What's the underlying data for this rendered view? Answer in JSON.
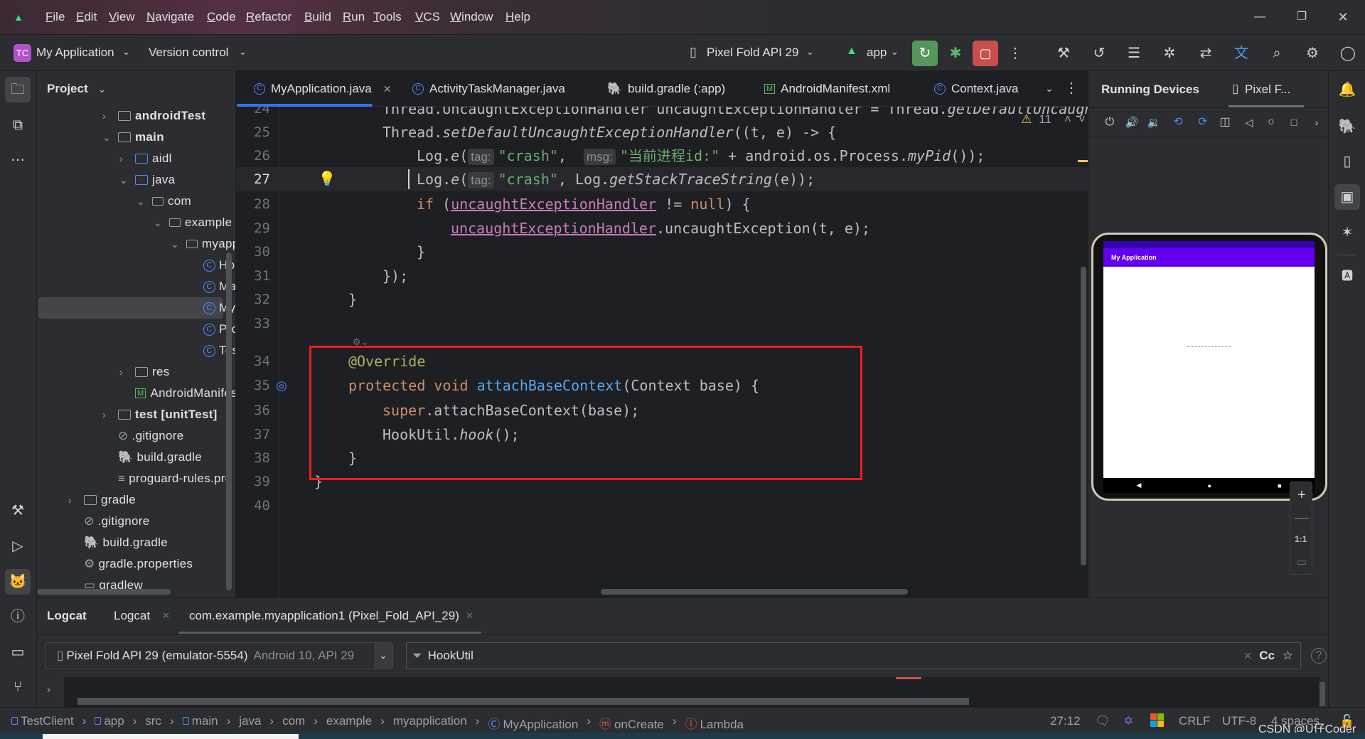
{
  "menubar": {
    "items": [
      "File",
      "Edit",
      "View",
      "Navigate",
      "Code",
      "Refactor",
      "Build",
      "Run",
      "Tools",
      "VCS",
      "Window",
      "Help"
    ]
  },
  "toolbar": {
    "project_badge": "TC",
    "project_name": "My Application",
    "version_control": "Version control",
    "device": "Pixel Fold API 29",
    "run_config": "app"
  },
  "project_panel": {
    "title": "Project",
    "items": [
      {
        "label": "androidTest",
        "type": "folder-src"
      },
      {
        "label": "main",
        "type": "folder-src"
      },
      {
        "label": "aidl",
        "type": "folder-blue"
      },
      {
        "label": "java",
        "type": "folder-blue"
      },
      {
        "label": "com",
        "type": "package"
      },
      {
        "label": "example",
        "type": "package"
      },
      {
        "label": "myapplication",
        "type": "package"
      },
      {
        "label": "HookUtil",
        "type": "class"
      },
      {
        "label": "MainActivity",
        "type": "class"
      },
      {
        "label": "MyApplication",
        "type": "class"
      },
      {
        "label": "ProxyActivity",
        "type": "class"
      },
      {
        "label": "TestActivity",
        "type": "class"
      },
      {
        "label": "res",
        "type": "folder-res"
      },
      {
        "label": "AndroidManifest.xml",
        "type": "manifest"
      },
      {
        "label": "test [unitTest]",
        "type": "folder-test"
      },
      {
        "label": ".gitignore",
        "type": "ignore"
      },
      {
        "label": "build.gradle",
        "type": "gradle"
      },
      {
        "label": "proguard-rules.pro",
        "type": "text"
      },
      {
        "label": "gradle",
        "type": "folder"
      },
      {
        "label": ".gitignore",
        "type": "ignore"
      },
      {
        "label": "build.gradle",
        "type": "gradle"
      },
      {
        "label": "gradle.properties",
        "type": "settings"
      },
      {
        "label": "gradlew",
        "type": "terminal"
      }
    ]
  },
  "editor": {
    "tabs": [
      {
        "label": "MyApplication.java",
        "active": true
      },
      {
        "label": "ActivityTaskManager.java"
      },
      {
        "label": "build.gradle (:app)"
      },
      {
        "label": "AndroidManifest.xml"
      },
      {
        "label": "Context.java"
      }
    ],
    "warning_count": "11",
    "current_line": 27,
    "lines": [
      {
        "n": "24",
        "indent": 2,
        "tokens": [
          [
            "Thread.UncaughtExceptionHandler uncaughtExceptionHandler = Thread.",
            ""
          ],
          [
            "getDefaultUncaughtExceptionHandler",
            "it"
          ],
          [
            "();",
            ""
          ]
        ]
      },
      {
        "n": "25",
        "indent": 2,
        "tokens": [
          [
            "Thread.",
            ""
          ],
          [
            "setDefaultUncaughtExceptionHandler",
            "it"
          ],
          [
            "((t, e) -> {",
            ""
          ]
        ]
      },
      {
        "n": "26",
        "indent": 3,
        "tokens": [
          [
            "Log.",
            ""
          ],
          [
            "e",
            "it"
          ],
          [
            "(",
            ""
          ],
          [
            "tag:",
            "hint"
          ],
          [
            "\"crash\"",
            "str"
          ],
          [
            ",  ",
            ""
          ],
          [
            "msg:",
            "hint"
          ],
          [
            "\"当前进程id:\"",
            "str"
          ],
          [
            " + android.os.Process.",
            ""
          ],
          [
            "myPid",
            "it"
          ],
          [
            "());",
            ""
          ]
        ]
      },
      {
        "n": "27",
        "indent": 3,
        "tokens": [
          [
            "Log.",
            ""
          ],
          [
            "e",
            "it"
          ],
          [
            "(",
            ""
          ],
          [
            "tag:",
            "hint"
          ],
          [
            "\"crash\"",
            "str"
          ],
          [
            ", Log.",
            ""
          ],
          [
            "getStackTraceString",
            "it"
          ],
          [
            "(e));",
            ""
          ]
        ]
      },
      {
        "n": "28",
        "indent": 3,
        "tokens": [
          [
            "if",
            "kw"
          ],
          [
            " (",
            ""
          ],
          [
            "uncaughtExceptionHandler",
            "fld"
          ],
          [
            " != ",
            ""
          ],
          [
            "null",
            "kw"
          ],
          [
            ") {",
            ""
          ]
        ]
      },
      {
        "n": "29",
        "indent": 4,
        "tokens": [
          [
            "uncaughtExceptionHandler",
            "fld"
          ],
          [
            ".uncaughtException(t, e);",
            ""
          ]
        ]
      },
      {
        "n": "30",
        "indent": 3,
        "tokens": [
          [
            "}",
            ""
          ]
        ]
      },
      {
        "n": "31",
        "indent": 2,
        "tokens": [
          [
            "});",
            ""
          ]
        ]
      },
      {
        "n": "32",
        "indent": 1,
        "tokens": [
          [
            "}",
            ""
          ]
        ]
      },
      {
        "n": "33",
        "indent": 0,
        "tokens": []
      },
      {
        "n": "34",
        "indent": 1,
        "tokens": [
          [
            "@Override",
            "ann"
          ]
        ]
      },
      {
        "n": "35",
        "indent": 1,
        "tokens": [
          [
            "protected void ",
            "kw"
          ],
          [
            "attachBaseContext",
            "mth"
          ],
          [
            "(Context base) {",
            ""
          ]
        ]
      },
      {
        "n": "36",
        "indent": 2,
        "tokens": [
          [
            "super",
            "kw"
          ],
          [
            ".attachBaseContext(base);",
            ""
          ]
        ]
      },
      {
        "n": "37",
        "indent": 2,
        "tokens": [
          [
            "HookUtil.",
            ""
          ],
          [
            "hook",
            "it"
          ],
          [
            "();",
            ""
          ]
        ]
      },
      {
        "n": "38",
        "indent": 1,
        "tokens": [
          [
            "}",
            ""
          ]
        ]
      },
      {
        "n": "39",
        "indent": 0,
        "tokens": [
          [
            "}",
            ""
          ]
        ]
      },
      {
        "n": "40",
        "indent": 0,
        "tokens": []
      }
    ]
  },
  "running_devices": {
    "title": "Running Devices",
    "device_tab": "Pixel F...",
    "app_title": "My Application",
    "zoom_reset": "1:1"
  },
  "logcat": {
    "title": "Logcat",
    "tabs": [
      {
        "label": "Logcat"
      },
      {
        "label": "com.example.myapplication1 (Pixel_Fold_API_29)",
        "active": true
      }
    ],
    "device": "Pixel Fold API 29 (emulator-5554)",
    "device_detail": "Android 10, API 29",
    "filter": "HookUtil",
    "case_label": "Cc"
  },
  "statusbar": {
    "breadcrumbs": [
      {
        "label": "TestClient",
        "icon": "module"
      },
      {
        "label": "app",
        "icon": "module"
      },
      {
        "label": "src"
      },
      {
        "label": "main",
        "icon": "module"
      },
      {
        "label": "java"
      },
      {
        "label": "com"
      },
      {
        "label": "example"
      },
      {
        "label": "myapplication"
      },
      {
        "label": "MyApplication",
        "icon": "class"
      },
      {
        "label": "onCreate",
        "icon": "method"
      },
      {
        "label": "Lambda",
        "icon": "lambda"
      }
    ],
    "position": "27:12",
    "line_separator": "CRLF",
    "encoding": "UTF-8",
    "indent": "4 spaces"
  },
  "watermark": "CSDN @U仔Coder",
  "colors": {
    "accent": "#3574f0",
    "run": "#57965c",
    "stop": "#c94f4f",
    "app_bar": "#6200ee",
    "highlight_box": "#f01d1d"
  }
}
